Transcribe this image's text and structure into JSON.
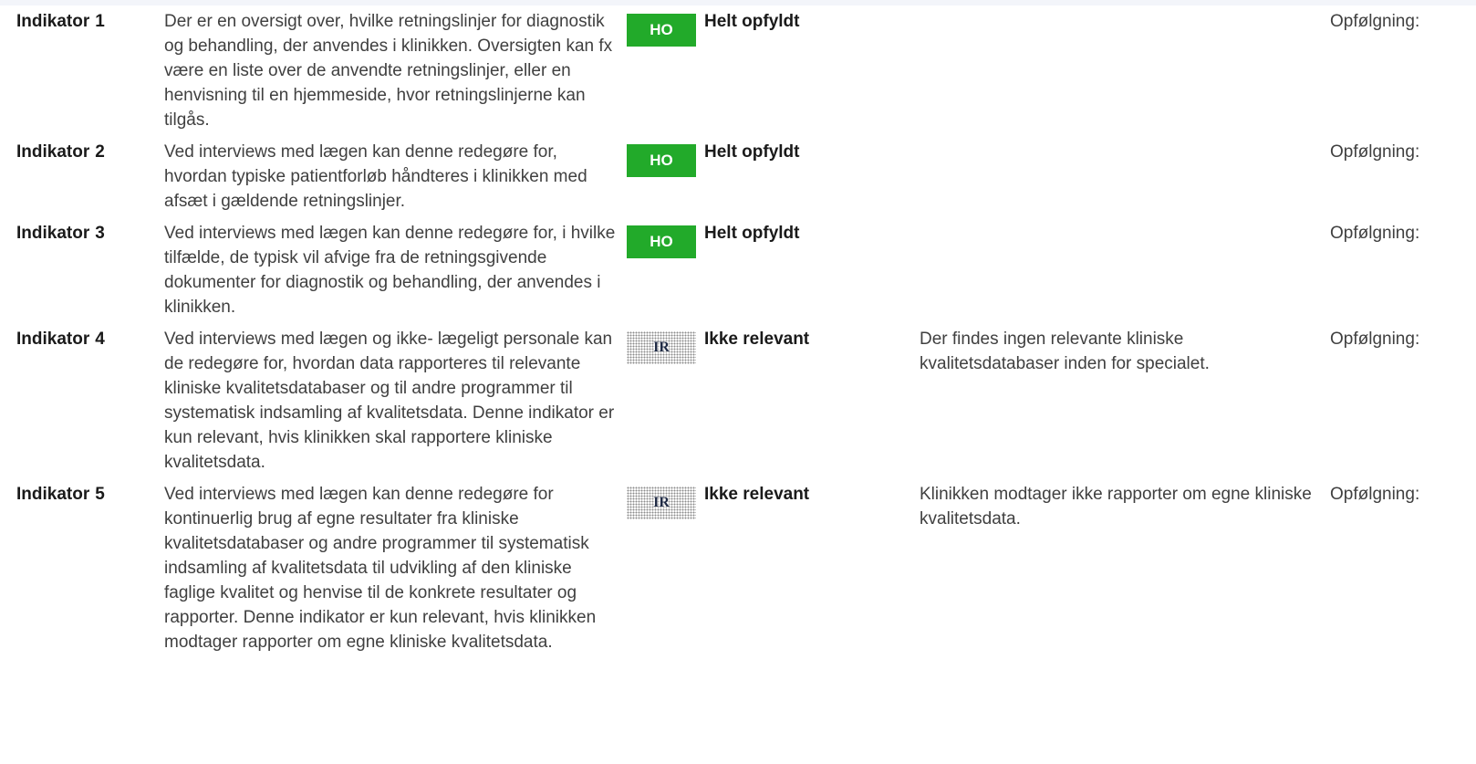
{
  "rows": [
    {
      "label": "Indikator",
      "number": "1",
      "description": "Der er en oversigt over, hvilke retningslinjer for diagnostik og behandling, der anvendes i klinikken.   Oversigten kan fx være en liste over de anvendte retningslinjer, eller en henvisning til en hjemmeside, hvor retningslinjerne kan tilgås.",
      "badge": "HO",
      "badge_type": "ho",
      "status": "Helt opfyldt",
      "note": "",
      "followup": "Opfølgning:"
    },
    {
      "label": "Indikator",
      "number": "2",
      "description": "Ved interviews med lægen kan denne redegøre for, hvordan typiske patientforløb håndteres i klinikken med afsæt i gældende retningslinjer.",
      "badge": "HO",
      "badge_type": "ho",
      "status": "Helt opfyldt",
      "note": "",
      "followup": "Opfølgning:"
    },
    {
      "label": "Indikator",
      "number": "3",
      "description": "Ved interviews med lægen kan denne redegøre for, i hvilke tilfælde, de typisk vil afvige fra de retningsgivende dokumenter for diagnostik og behandling, der anvendes i klinikken.",
      "badge": "HO",
      "badge_type": "ho",
      "status": "Helt opfyldt",
      "note": "",
      "followup": "Opfølgning:"
    },
    {
      "label": "Indikator",
      "number": "4",
      "description": "Ved interviews med lægen og ikke- lægeligt personale kan de redegøre for, hvordan data rapporteres til relevante kliniske kvalitetsdatabaser og til andre programmer til systematisk indsamling af kvalitetsdata.   Denne indikator er kun relevant, hvis klinikken skal rapportere kliniske kvalitetsdata.",
      "badge": "IR",
      "badge_type": "ir",
      "status": "Ikke relevant",
      "note": "Der findes ingen relevante kliniske kvalitetsdatabaser inden for specialet.",
      "followup": "Opfølgning:"
    },
    {
      "label": "Indikator",
      "number": "5",
      "description": "Ved interviews med lægen kan denne redegøre for kontinuerlig brug af egne resultater fra kliniske kvalitetsdatabaser og andre programmer til systematisk indsamling af kvalitetsdata til udvikling af den kliniske faglige kvalitet og henvise til de konkrete resultater og rapporter.   Denne indikator er kun relevant, hvis klinikken modtager rapporter om egne kliniske kvalitetsdata.",
      "badge": "IR",
      "badge_type": "ir",
      "status": "Ikke relevant",
      "note": "Klinikken modtager ikke rapporter om egne kliniske kvalitetsdata.",
      "followup": "Opfølgning:"
    }
  ],
  "colors": {
    "ho_badge": "#22aa2a",
    "text": "#404040",
    "label_text": "#1a1a1a"
  }
}
